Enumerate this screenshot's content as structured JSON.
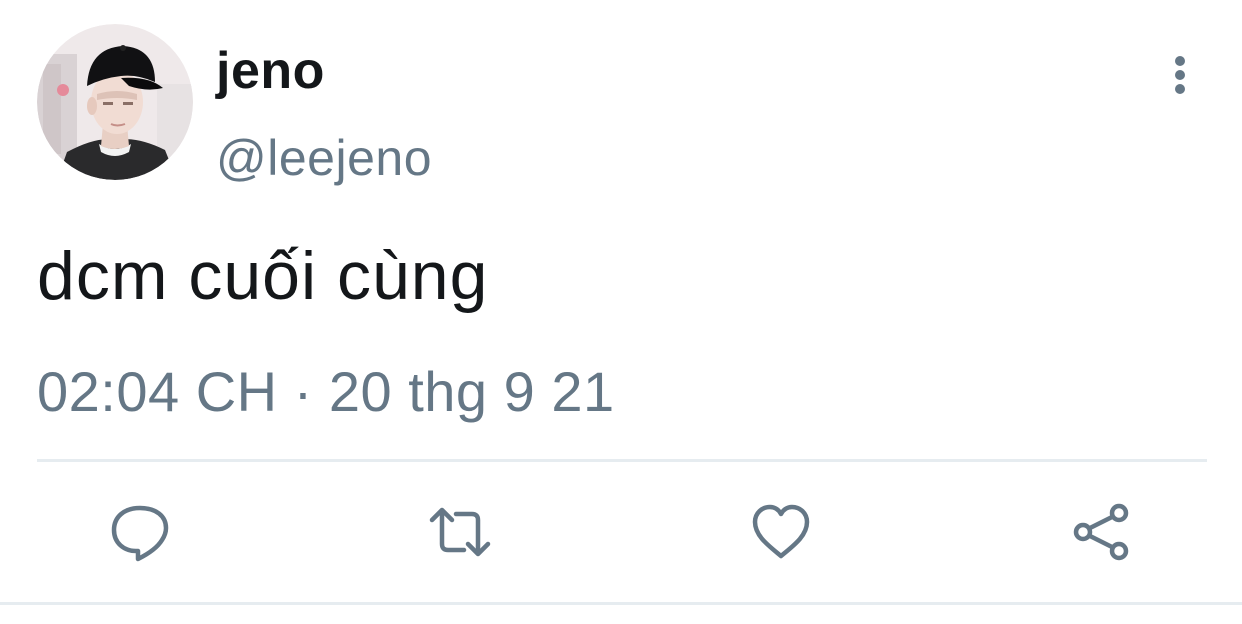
{
  "author": {
    "display_name": "jeno",
    "handle": "@leejeno"
  },
  "tweet": {
    "text": "dcm cuối cùng",
    "time": "02:04 CH",
    "separator": "·",
    "date": "20 thg 9 21"
  },
  "actions": {
    "reply_icon": "reply-icon",
    "retweet_icon": "retweet-icon",
    "like_icon": "heart-icon",
    "share_icon": "share-icon",
    "more_icon": "more-vertical-icon"
  },
  "colors": {
    "text_primary": "#14171a",
    "text_secondary": "#657786",
    "icon": "#657786",
    "divider": "#e6ecf0"
  }
}
